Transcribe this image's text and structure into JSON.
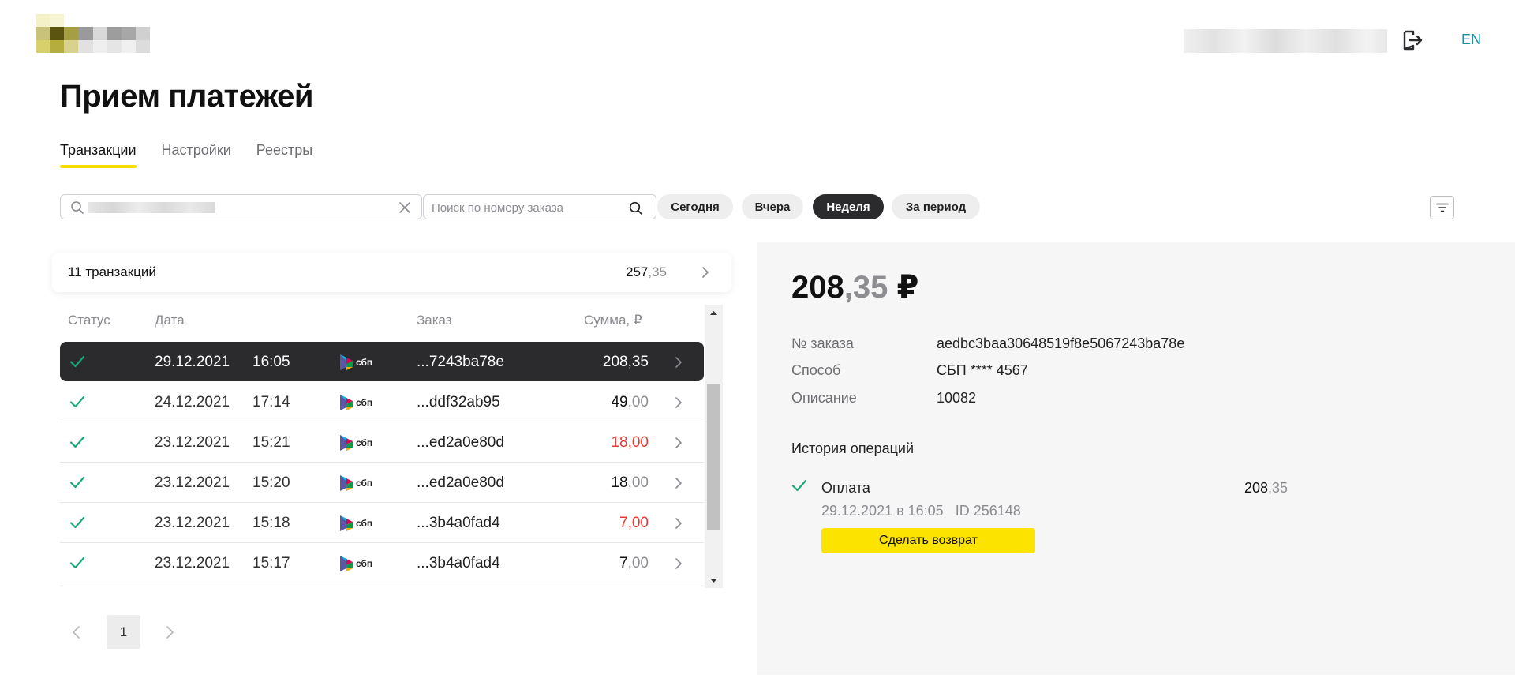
{
  "header": {
    "lang_label": "EN",
    "logout_icon": "logout-icon"
  },
  "page": {
    "title": "Прием платежей"
  },
  "tabs": [
    {
      "label": "Транзакции",
      "active": true
    },
    {
      "label": "Настройки",
      "active": false
    },
    {
      "label": "Реестры",
      "active": false
    }
  ],
  "filters": {
    "order_search_placeholder": "Поиск по номеру заказа",
    "periods": [
      {
        "label": "Сегодня",
        "active": false
      },
      {
        "label": "Вчера",
        "active": false
      },
      {
        "label": "Неделя",
        "active": true
      },
      {
        "label": "За период",
        "active": false
      }
    ]
  },
  "summary": {
    "count_label": "11 транзакций",
    "amount_int": "257",
    "amount_frac": ",35"
  },
  "table": {
    "columns": {
      "status": "Статус",
      "date": "Дата",
      "order": "Заказ",
      "sum": "Сумма, ₽"
    },
    "rows": [
      {
        "date": "29.12.2021",
        "time": "16:05",
        "method": "сбп",
        "order": "...7243ba78e",
        "amount_int": "208",
        "amount_frac": ",35",
        "negative": false,
        "selected": true
      },
      {
        "date": "24.12.2021",
        "time": "17:14",
        "method": "сбп",
        "order": "...ddf32ab95",
        "amount_int": "49",
        "amount_frac": ",00",
        "negative": false,
        "selected": false
      },
      {
        "date": "23.12.2021",
        "time": "15:21",
        "method": "сбп",
        "order": "...ed2a0e80d",
        "amount_int": "18",
        "amount_frac": ",00",
        "negative": true,
        "selected": false
      },
      {
        "date": "23.12.2021",
        "time": "15:20",
        "method": "сбп",
        "order": "...ed2a0e80d",
        "amount_int": "18",
        "amount_frac": ",00",
        "negative": false,
        "selected": false
      },
      {
        "date": "23.12.2021",
        "time": "15:18",
        "method": "сбп",
        "order": "...3b4a0fad4",
        "amount_int": "7",
        "amount_frac": ",00",
        "negative": true,
        "selected": false
      },
      {
        "date": "23.12.2021",
        "time": "15:17",
        "method": "сбп",
        "order": "...3b4a0fad4",
        "amount_int": "7",
        "amount_frac": ",00",
        "negative": false,
        "selected": false
      }
    ]
  },
  "pagination": {
    "current_page": "1"
  },
  "detail": {
    "amount_int": "208",
    "amount_frac": ",35",
    "currency": " ₽",
    "fields": [
      {
        "key": "№ заказа",
        "value": "aedbc3baa30648519f8e5067243ba78e"
      },
      {
        "key": "Способ",
        "value": "СБП **** 4567"
      },
      {
        "key": "Описание",
        "value": "10082"
      }
    ],
    "history_title": "История операций",
    "history": {
      "name": "Оплата",
      "meta": "29.12.2021 в 16:05   ID 256148",
      "amount_int": "208",
      "amount_frac": ",35"
    },
    "refund_label": "Сделать возврат"
  },
  "colors": {
    "accent_yellow": "#fde300",
    "success_green": "#1aa779",
    "negative_red": "#e53935",
    "dark": "#2b2b2e",
    "link_teal": "#1c8ea1"
  }
}
